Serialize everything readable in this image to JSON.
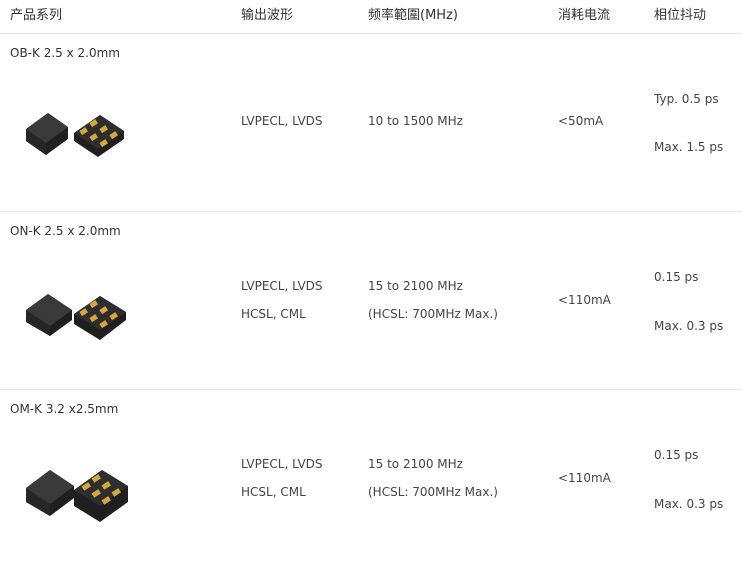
{
  "header": {
    "col_series": "产品系列",
    "col_output": "输出波形",
    "col_freq": "频率範圍(MHz)",
    "col_current": "消耗电流",
    "col_jitter": "相位抖动"
  },
  "rows": [
    {
      "name": "OB-K 2.5 x 2.0mm",
      "output": [
        "LVPECL, LVDS"
      ],
      "freq": [
        "10 to 1500 MHz"
      ],
      "current": "<50mA",
      "jitter": [
        "Typ. 0.5 ps",
        "Max. 1.5 ps"
      ]
    },
    {
      "name": "ON-K 2.5 x 2.0mm",
      "output": [
        "LVPECL, LVDS",
        "HCSL, CML"
      ],
      "freq": [
        "15 to 2100 MHz",
        "(HCSL: 700MHz Max.)"
      ],
      "current": "<110mA",
      "jitter": [
        "0.15 ps",
        "Max. 0.3 ps"
      ]
    },
    {
      "name": "OM-K 3.2 x2.5mm",
      "output": [
        "LVPECL, LVDS",
        "HCSL, CML"
      ],
      "freq": [
        "15 to 2100 MHz",
        "(HCSL: 700MHz Max.)"
      ],
      "current": "<110mA",
      "jitter": [
        "0.15 ps",
        "Max. 0.3 ps"
      ]
    }
  ],
  "colors": {
    "divider": "#e6e6e6",
    "package_dark": "#2f2f2f",
    "pad_gold": "#d4a93a"
  }
}
